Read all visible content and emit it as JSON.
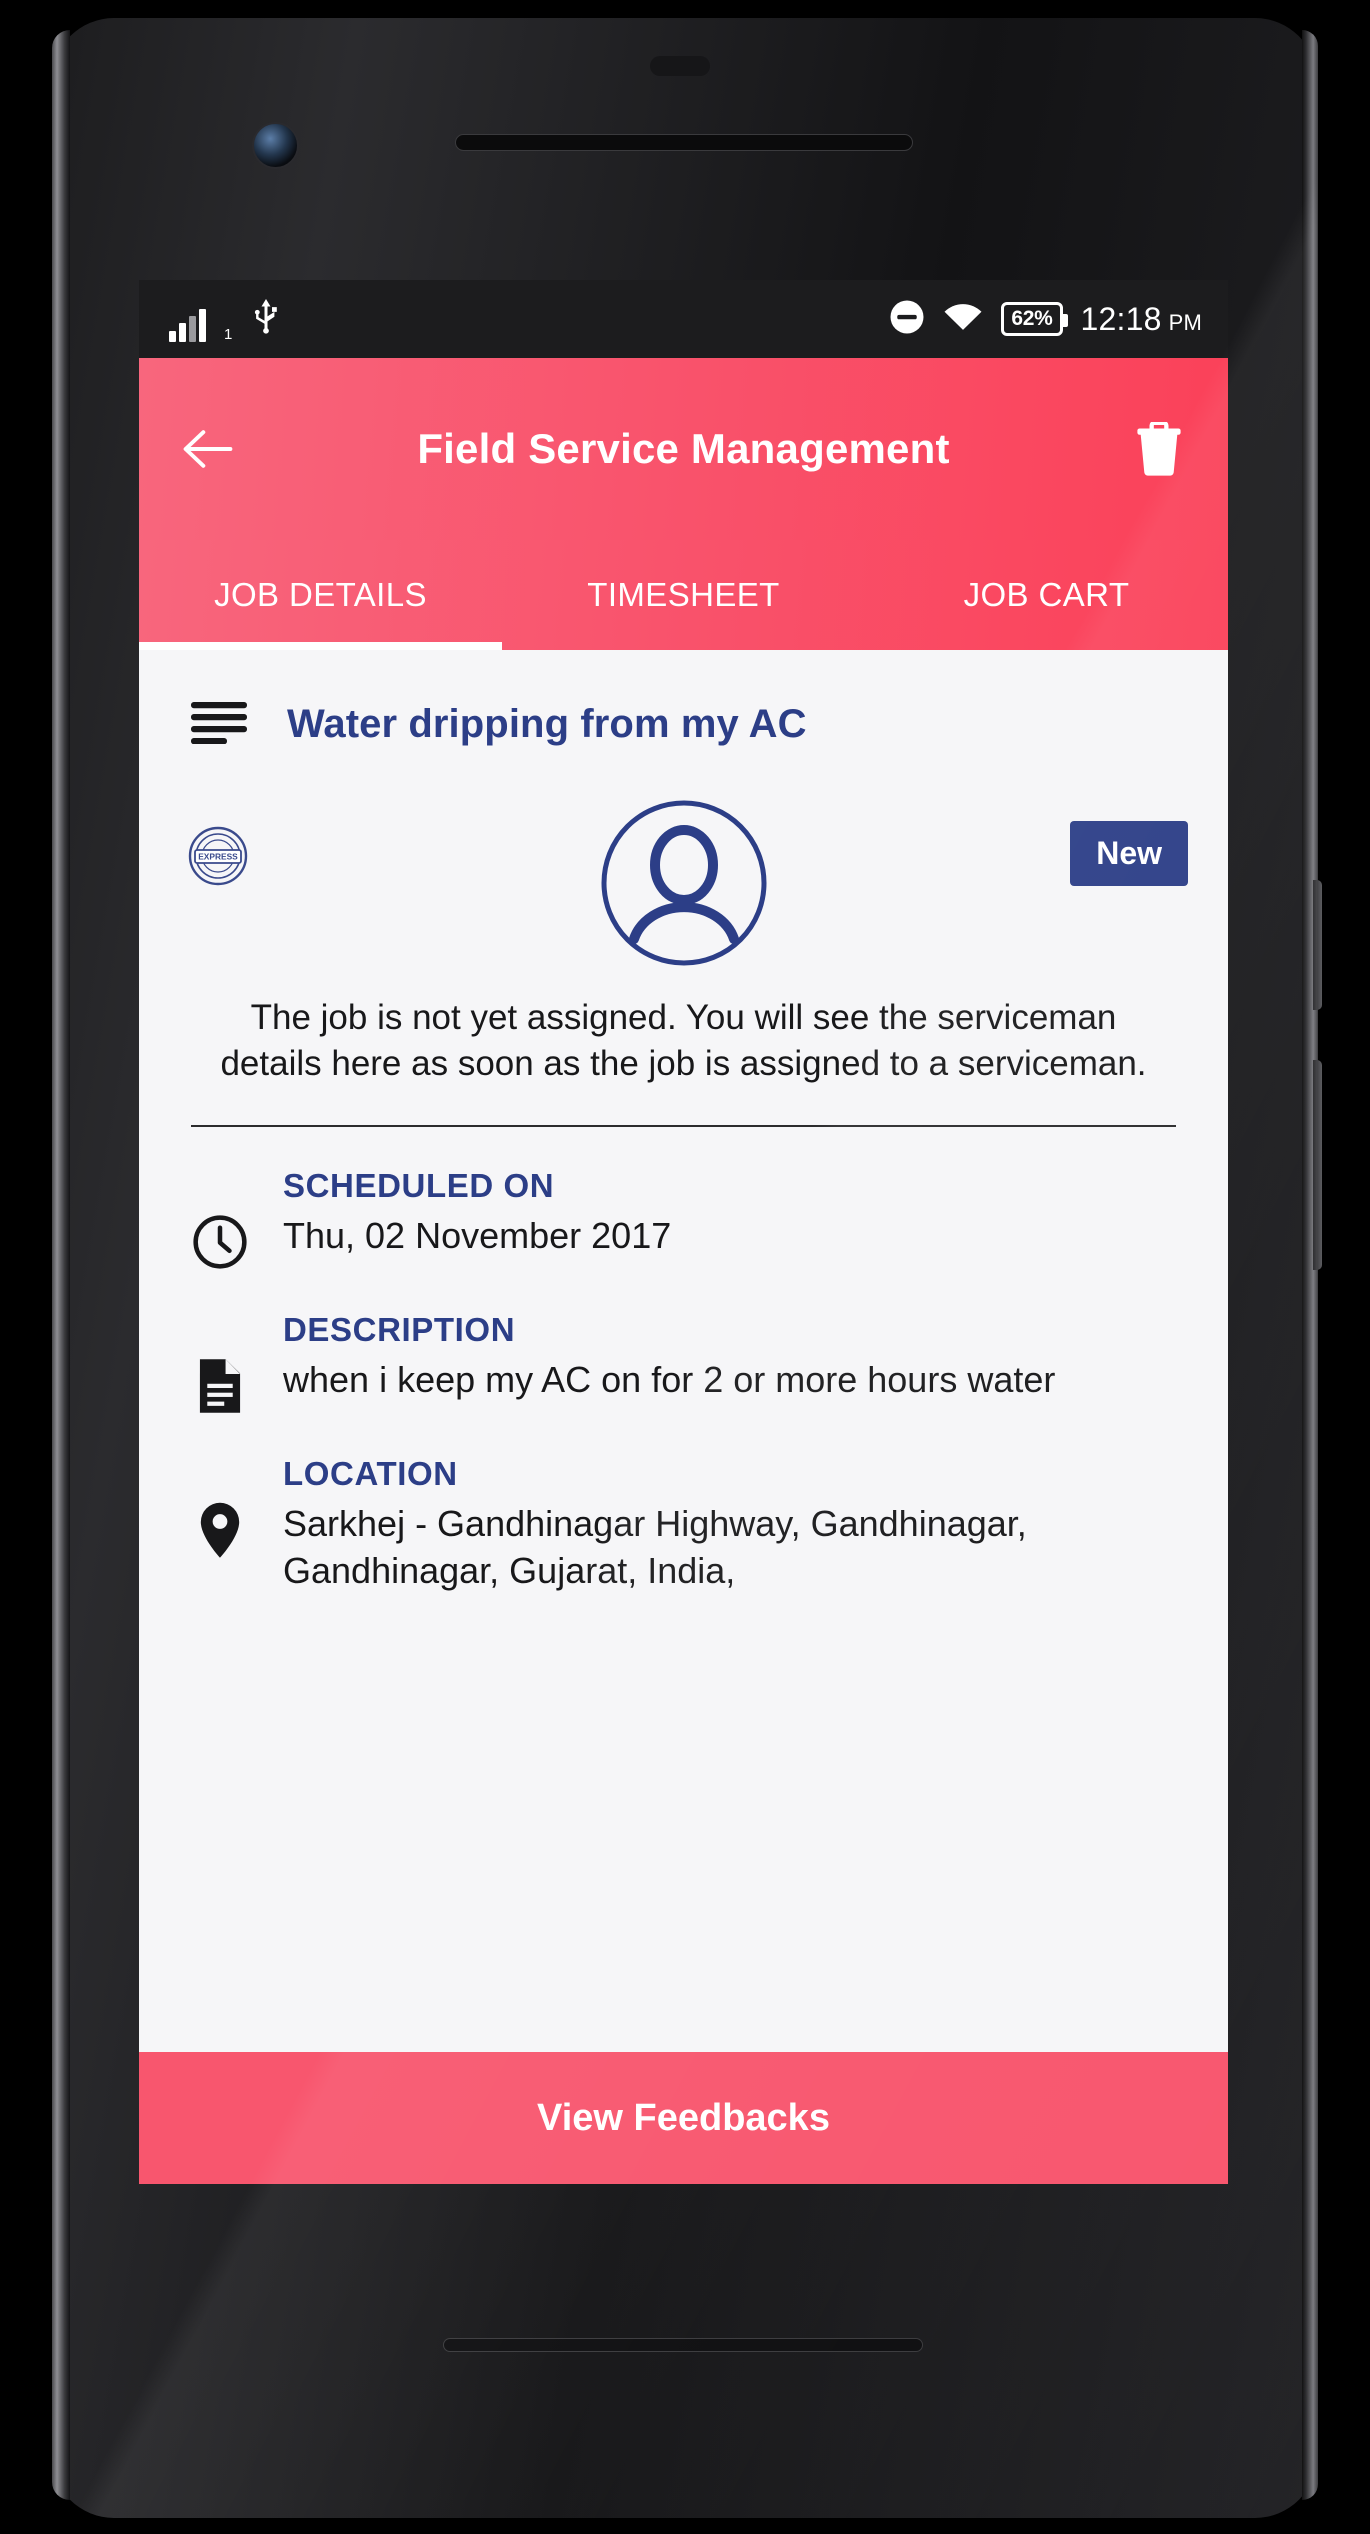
{
  "device": {
    "frame": "android-phone-mockup"
  },
  "statusbar": {
    "signal_label": "signal-bars",
    "sim_indicator": "1",
    "usb_label": "usb-icon",
    "dnd_label": "do-not-disturb-icon",
    "wifi_label": "wifi-icon",
    "battery_percent": "62%",
    "time": "12:18",
    "am_pm": "PM"
  },
  "appbar": {
    "back_label": "back-arrow",
    "title": "Field Service Management",
    "delete_label": "delete-job"
  },
  "tabs": [
    {
      "label": "JOB DETAILS",
      "active": true
    },
    {
      "label": "TIMESHEET",
      "active": false
    },
    {
      "label": "JOB CART",
      "active": false
    }
  ],
  "job": {
    "subject_icon": "subject-lines-icon",
    "title": "Water dripping from my AC",
    "express_badge": "EXPRESS",
    "status_badge": "New",
    "assignment_note": "The job is not yet assigned. You will see the serviceman details here as soon as the job is assigned to a serviceman."
  },
  "details": [
    {
      "icon": "clock-icon",
      "label": "SCHEDULED ON",
      "value": "Thu, 02 November 2017"
    },
    {
      "icon": "document-icon",
      "label": "DESCRIPTION",
      "value": "when i keep my AC on for 2 or more hours water"
    },
    {
      "icon": "location-pin-icon",
      "label": "LOCATION",
      "value": "Sarkhej - Gandhinagar Highway, Gandhinagar, Gandhinagar, Gujarat, India,"
    }
  ],
  "cta": {
    "label": "View Feedbacks"
  },
  "colors": {
    "accent_pink": "#F8566E",
    "brand_blue": "#2C3E87",
    "screen_bg": "#F6F6F8",
    "statusbar_bg": "#1C1C1E"
  }
}
